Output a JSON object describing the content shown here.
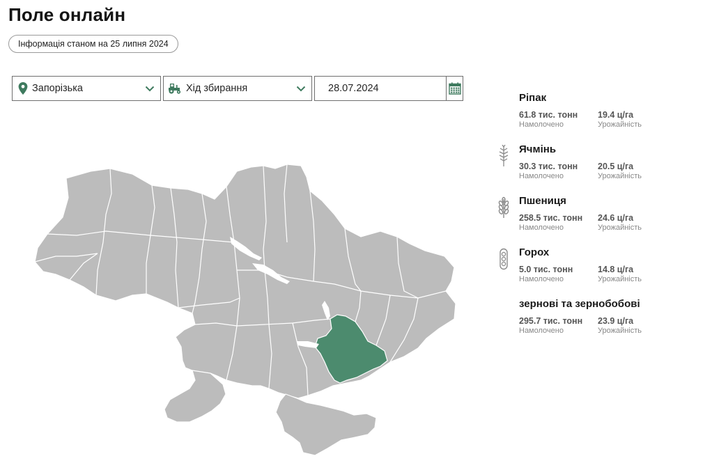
{
  "header": {
    "title": "Поле онлайн",
    "info": "Інформація станом на 25 липня 2024"
  },
  "filters": {
    "region": {
      "value": "Запорізька",
      "icon": "location-pin-icon"
    },
    "mode": {
      "value": "Хід збирання",
      "icon": "tractor-icon"
    },
    "date": {
      "value": "28.07.2024",
      "icon": "calendar-icon"
    }
  },
  "map": {
    "selected_region": "Запорізька",
    "selected_color": "#4c8b6e",
    "region_color": "#bcbcbc",
    "border_color": "#ffffff"
  },
  "crops": [
    {
      "name": "Ріпак",
      "icon": "",
      "harvested": "61.8 тис. тонн",
      "harvested_label": "Намолочено",
      "yield": "19.4 ц/га",
      "yield_label": "Урожайність"
    },
    {
      "name": "Ячмінь",
      "icon": "barley-icon",
      "harvested": "30.3 тис. тонн",
      "harvested_label": "Намолочено",
      "yield": "20.5 ц/га",
      "yield_label": "Урожайність"
    },
    {
      "name": "Пшениця",
      "icon": "wheat-icon",
      "harvested": "258.5 тис. тонн",
      "harvested_label": "Намолочено",
      "yield": "24.6 ц/га",
      "yield_label": "Урожайність"
    },
    {
      "name": "Горох",
      "icon": "pea-pod-icon",
      "harvested": "5.0 тис. тонн",
      "harvested_label": "Намолочено",
      "yield": "14.8 ц/га",
      "yield_label": "Урожайність"
    },
    {
      "name": "зернові та зернобобові",
      "icon": "",
      "harvested": "295.7 тис. тонн",
      "harvested_label": "Намолочено",
      "yield": "23.9 ц/га",
      "yield_label": "Урожайність"
    }
  ]
}
